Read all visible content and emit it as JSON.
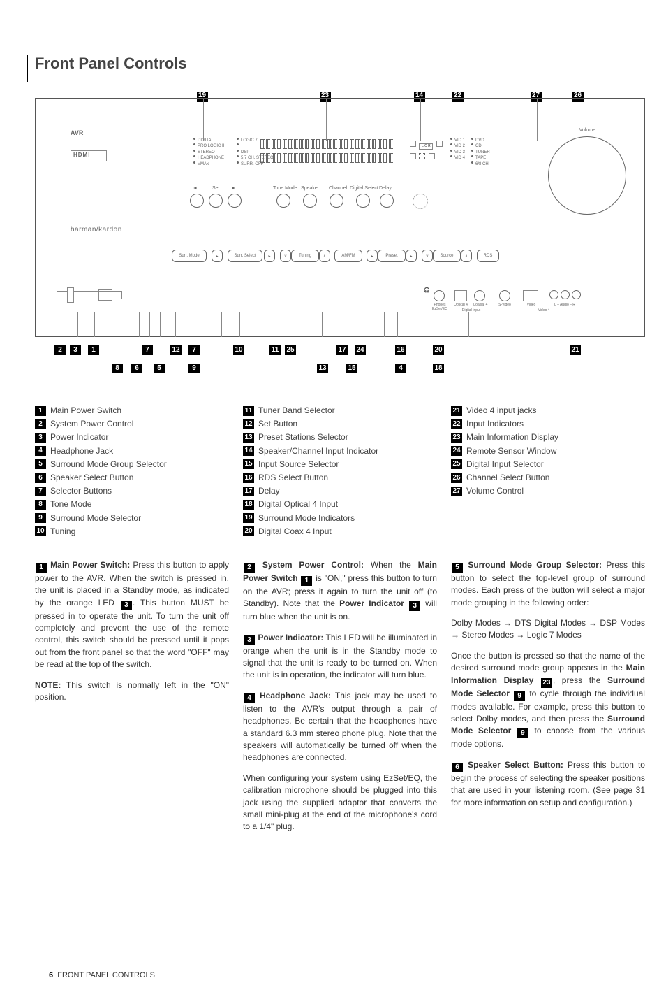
{
  "title": "Front Panel Controls",
  "arrow": "→",
  "c": {
    "1": "1",
    "2": "2",
    "3": "3",
    "4": "4",
    "5": "5",
    "6": "6",
    "7": "7",
    "8": "8",
    "9": "9",
    "10": "10",
    "11": "11",
    "12": "12",
    "13": "13",
    "14": "14",
    "15": "15",
    "16": "16",
    "17": "17",
    "18": "18",
    "19": "19",
    "20": "20",
    "21": "21",
    "22": "22",
    "23": "23",
    "24": "24",
    "25": "25",
    "26": "26",
    "27": "27"
  },
  "diagram": {
    "avr": "AVR",
    "hdmi": "HDMI",
    "brand": "harman/kardon",
    "volume_label": "Volume",
    "ind": [
      "DIGITAL",
      "PRO LOGIC II",
      "STEREO",
      "HEADPHONE",
      "VMAx"
    ],
    "ind2": [
      "LOGIC 7",
      "",
      "DSP",
      "5.7 CH. STEREO",
      "SURR. OFF"
    ],
    "spk": {
      "lcr": "L C R",
      "bl": ""
    },
    "inputs": [
      "VID 1",
      "VID 2",
      "VID 3",
      "VID 4"
    ],
    "inputs2": [
      "DVD",
      "CD",
      "TUNER",
      "TAPE",
      "6/8 CH"
    ],
    "knob_labels": {
      "set": "Set",
      "tone": "Tone Mode",
      "speaker": "Speaker",
      "channel": "Channel",
      "digital": "Digital Select",
      "delay": "Delay"
    },
    "btns": {
      "surr": "Surr. Mode",
      "surr_sel": "Surr. Select",
      "tuning": "Tuning",
      "amfm": "AM/FM",
      "preset": "Preset",
      "source": "Source",
      "rds": "RDS"
    },
    "ports": {
      "phones": "Phones EzSet/EQ",
      "opt": "Optical 4",
      "coax": "Coaxial 4",
      "digin": "Digital Input",
      "svideo": "S-Video",
      "video": "Video",
      "laudio": "L – Audio – R",
      "vid4": "Video 4"
    }
  },
  "legend": {
    "1": "Main Power Switch",
    "2": "System Power Control",
    "3": "Power Indicator",
    "4": "Headphone Jack",
    "5": "Surround Mode Group Selector",
    "6": "Speaker Select Button",
    "7": "Selector Buttons",
    "8": "Tone Mode",
    "9": "Surround Mode Selector",
    "10": "Tuning",
    "11": "Tuner Band Selector",
    "12": "Set Button",
    "13": "Preset Stations Selector",
    "14": "Speaker/Channel Input Indicator",
    "15": "Input Source Selector",
    "16": "RDS Select Button",
    "17": "Delay",
    "18": "Digital Optical 4 Input",
    "19": "Surround Mode Indicators",
    "20": "Digital Coax 4 Input",
    "21": "Video 4 input jacks",
    "22": "Input Indicators",
    "23": "Main Information Display",
    "24": "Remote Sensor Window",
    "25": "Digital Input Selector",
    "26": "Channel Select Button",
    "27": "Volume Control"
  },
  "body": {
    "p1": {
      "h": "Main Power Switch:",
      "a": "Press this button to apply power to the AVR. When the switch is pressed in, the unit is placed in a Standby mode, as indicated by the orange LED",
      "b": ". This button MUST be pressed in to operate the unit. To turn the unit off completely and prevent the use of the remote control, this switch should be pressed until it pops out from the front panel so that the word \"OFF\" may be read at the top of the switch."
    },
    "note": {
      "h": "NOTE:",
      "t": "This switch is normally left in the \"ON\" position."
    },
    "p2": {
      "h": "System Power Control:",
      "a": "When the",
      "b": "Main Power Switch",
      "c": "is \"ON,\" press this button to turn on the AVR; press it again to turn the unit off (to Standby). Note that the",
      "d": "Power Indicator",
      "e": "will turn blue when the unit is on."
    },
    "p3": {
      "h": "Power Indicator:",
      "t": "This LED will be illuminated in orange when the unit is in the Standby mode to signal that the unit is ready to be turned on. When the unit is in operation, the indicator will turn blue."
    },
    "p4": {
      "h": "Headphone Jack:",
      "t": "This jack may be used to listen to the AVR's output through a pair of headphones. Be certain that the headphones have a standard 6.3 mm stereo phone plug. Note that the speakers will automatically be turned off when the headphones are connected."
    },
    "p4b": "When configuring your system using EzSet/EQ, the calibration microphone should be plugged into this jack using the supplied adaptor that converts the small mini-plug at the end of the microphone's cord to a 1/4\" plug.",
    "p5": {
      "h": "Surround Mode Group Selector:",
      "t": "Press this button to select the top-level group of surround modes. Each press of the button will select a major mode grouping in the following order:"
    },
    "p5b": {
      "a": "Dolby Modes",
      "b": "DTS Digital Modes",
      "c": "DSP Modes",
      "d": "Stereo Modes",
      "e": "Logic 7 Modes"
    },
    "p5c": {
      "a": "Once the button is pressed so that the name of the desired surround mode group appears in the",
      "b": "Main Information Display",
      "c": ", press the",
      "d": "Surround Mode Selector",
      "e": "to cycle through the individual modes available. For example, press this button to select Dolby modes, and then press the",
      "f": "to choose from the various mode options."
    },
    "p6": {
      "h": "Speaker Select Button:",
      "t": "Press this button to begin the process of selecting the speaker positions that are used in your listening room. (See page 31 for more information on setup and configuration.)"
    }
  },
  "footer": {
    "num": "6",
    "txt": "FRONT PANEL CONTROLS"
  }
}
